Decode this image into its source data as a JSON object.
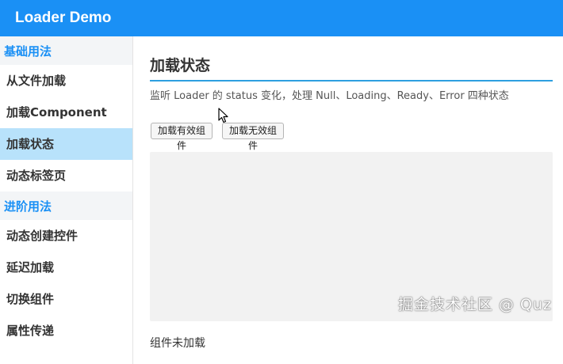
{
  "app": {
    "title": "Loader Demo"
  },
  "sidebar": {
    "groups": [
      {
        "title": "基础用法",
        "items": [
          {
            "label": "从文件加载"
          },
          {
            "label": "加载Component"
          },
          {
            "label": "加载状态",
            "active": true
          },
          {
            "label": "动态标签页"
          }
        ]
      },
      {
        "title": "进阶用法",
        "items": [
          {
            "label": "动态创建控件"
          },
          {
            "label": "延迟加载"
          },
          {
            "label": "切换组件"
          },
          {
            "label": "属性传递"
          }
        ]
      }
    ]
  },
  "main": {
    "title": "加载状态",
    "description": "监听 Loader 的 status 变化，处理 Null、Loading、Ready、Error 四种状态",
    "buttons": {
      "load_valid": "加载有效组件",
      "load_invalid": "加载无效组件"
    },
    "status": "组件未加载"
  },
  "watermark": "掘金技术社区 @ Quz",
  "colors": {
    "header": "#1a90f5",
    "active_item": "#b8e2fb",
    "group_title": "#1a90f5",
    "title_rule": "#2d9fe0"
  },
  "icons": {
    "cursor": "mouse-pointer-icon"
  }
}
